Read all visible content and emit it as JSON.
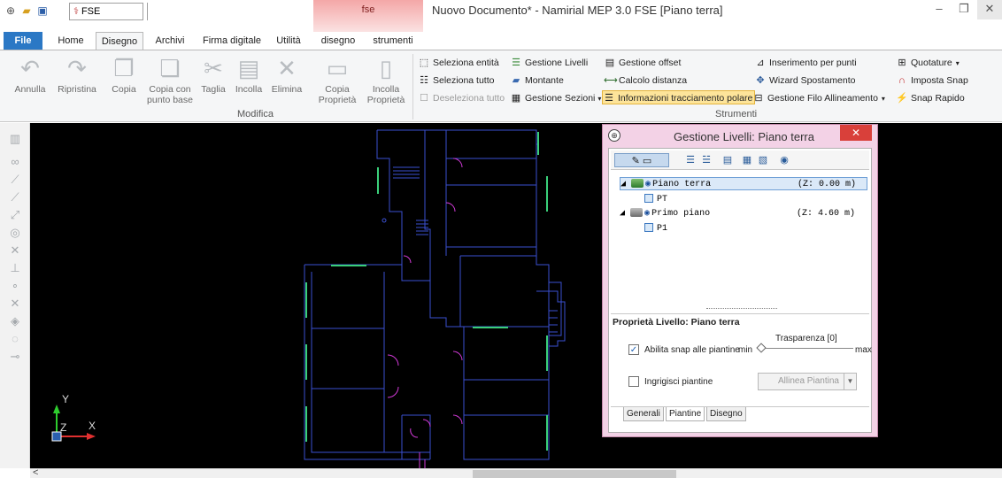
{
  "title_bar": {
    "doc_combo": "FSE",
    "context_tab_title": "fse",
    "window_title": "Nuovo Documento* - Namirial MEP 3.0 FSE [Piano terra]",
    "minimize": "–",
    "restore": "❐",
    "close": "✕"
  },
  "tabs": {
    "file": "File",
    "home": "Home",
    "disegno": "Disegno",
    "archivi": "Archivi",
    "firma": "Firma digitale",
    "utilita": "Utilità",
    "ctx_disegno": "disegno",
    "ctx_strumenti": "strumenti"
  },
  "ribbon": {
    "modifica": {
      "annulla": "Annulla",
      "ripristina": "Ripristina",
      "copia": "Copia",
      "copia_base_1": "Copia con",
      "copia_base_2": "punto base",
      "taglia": "Taglia",
      "incolla": "Incolla",
      "elimina": "Elimina",
      "copia_prop_1": "Copia",
      "copia_prop_2": "Proprietà",
      "incolla_prop_1": "Incolla",
      "incolla_prop_2": "Proprietà",
      "group_label": "Modifica"
    },
    "strumenti": {
      "seleziona_entita": "Seleziona entità",
      "seleziona_tutto": "Seleziona tutto",
      "deseleziona_tutto": "Deseleziona tutto",
      "gestione_livelli": "Gestione Livelli",
      "montante": "Montante",
      "gestione_sezioni": "Gestione Sezioni",
      "gestione_offset": "Gestione offset",
      "calcolo_distanza": "Calcolo distanza",
      "info_polare": "Informazioni tracciamento polare",
      "inserimento_punti": "Inserimento per punti",
      "wizard_spostamento": "Wizard Spostamento",
      "gestione_filo": "Gestione Filo Allineamento",
      "quotature": "Quotature",
      "imposta_snap": "Imposta Snap",
      "snap_rapido": "Snap Rapido",
      "group_label": "Strumenti"
    }
  },
  "canvas": {
    "axis_y": "Y",
    "axis_z": "Z",
    "axis_x": "X"
  },
  "scrollbar": {
    "left_arrow": "<"
  },
  "dialog": {
    "title": "Gestione Livelli: Piano terra",
    "close": "✕",
    "tree": [
      {
        "name": "Piano terra",
        "z": "(Z:  0.00 m)",
        "plan": "PT"
      },
      {
        "name": "Primo piano",
        "z": "(Z:  4.60 m)",
        "plan": "P1"
      }
    ],
    "props_title": "Proprietà Livello: Piano terra",
    "snap_label": "Abilita snap alle piantine",
    "snap_checked": true,
    "trasparenza_label": "Trasparenza [0]",
    "min_label": "min",
    "max_label": "max",
    "trasparenza_value": 0,
    "ingrigisci_label": "Ingrigisci piantine",
    "ingrigisci_checked": false,
    "allinea_label": "Allinea Piantina",
    "tabs": [
      "Generali",
      "Piantine",
      "Disegno"
    ],
    "active_tab": "Piantine"
  },
  "colors": {
    "file_tab": "#2b78c5",
    "context_tab": "#f4a7a7",
    "dialog_frame": "#f3d2e6",
    "highlight": "#fde49a",
    "canvas": "#000000",
    "wall_blue": "#3a4fd0",
    "door_magenta": "#d23ad8",
    "window_green": "#3acf7a",
    "axis_y": "#2ecc2e",
    "axis_x": "#e03030"
  }
}
